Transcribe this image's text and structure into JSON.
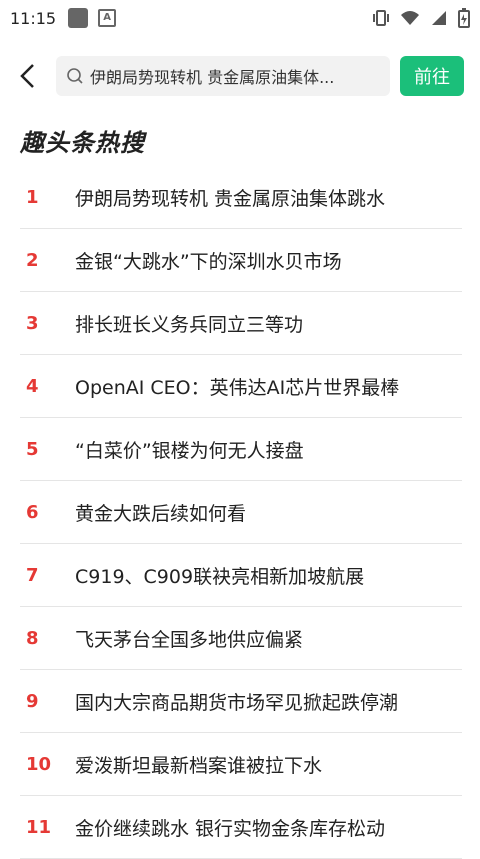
{
  "status": {
    "time": "11:15"
  },
  "search": {
    "query": "伊朗局势现转机 贵金属原油集体...",
    "go_label": "前往"
  },
  "section": {
    "title": "趣头条热搜"
  },
  "list": [
    {
      "rank": "1",
      "text": "伊朗局势现转机 贵金属原油集体跳水"
    },
    {
      "rank": "2",
      "text": "金银“大跳水”下的深圳水贝市场"
    },
    {
      "rank": "3",
      "text": "排长班长义务兵同立三等功"
    },
    {
      "rank": "4",
      "text": "OpenAI CEO：英伟达AI芯片世界最棒"
    },
    {
      "rank": "5",
      "text": "“白菜价”银楼为何无人接盘"
    },
    {
      "rank": "6",
      "text": "黄金大跌后续如何看"
    },
    {
      "rank": "7",
      "text": "C919、C909联袂亮相新加坡航展"
    },
    {
      "rank": "8",
      "text": "飞天茅台全国多地供应偏紧"
    },
    {
      "rank": "9",
      "text": "国内大宗商品期货市场罕见掀起跌停潮"
    },
    {
      "rank": "10",
      "text": "爱泼斯坦最新档案谁被拉下水"
    },
    {
      "rank": "11",
      "text": "金价继续跳水 银行实物金条库存松动"
    }
  ],
  "colors": {
    "accent": "#1bbf7a",
    "rank": "#e53935"
  }
}
